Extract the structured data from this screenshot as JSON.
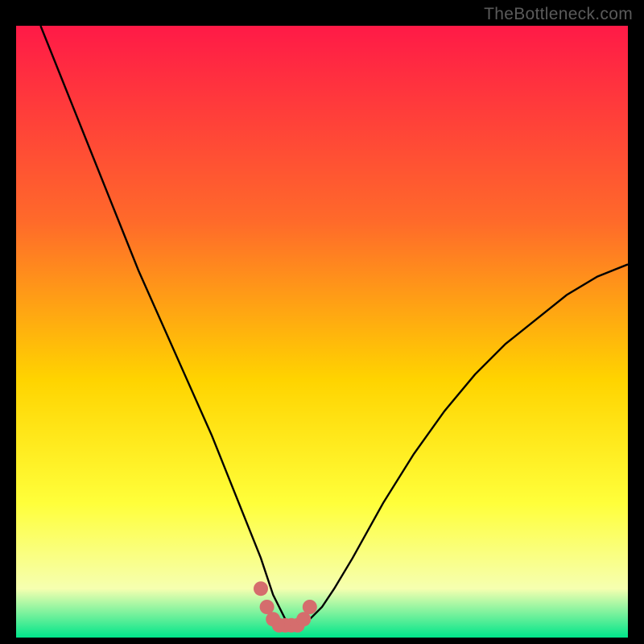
{
  "watermark": "TheBottleneck.com",
  "colors": {
    "gradient_top": "#ff1a47",
    "gradient_mid1": "#ff6a2a",
    "gradient_mid2": "#ffd400",
    "gradient_mid3": "#ffff3a",
    "gradient_mid4": "#f6ffb0",
    "gradient_bottom": "#00e58a",
    "curve": "#000000",
    "marker": "#d56d6d"
  },
  "chart_data": {
    "type": "line",
    "title": "",
    "xlabel": "",
    "ylabel": "",
    "xlim": [
      0,
      100
    ],
    "ylim": [
      0,
      100
    ],
    "series": [
      {
        "name": "curve",
        "x": [
          4,
          8,
          12,
          16,
          20,
          24,
          28,
          32,
          34,
          36,
          38,
          40,
          41,
          42,
          43,
          44,
          45,
          46,
          47,
          48,
          50,
          52,
          55,
          60,
          65,
          70,
          75,
          80,
          85,
          90,
          95,
          100
        ],
        "y": [
          100,
          90,
          80,
          70,
          60,
          51,
          42,
          33,
          28,
          23,
          18,
          13,
          10,
          7,
          5,
          3,
          2,
          2,
          2,
          3,
          5,
          8,
          13,
          22,
          30,
          37,
          43,
          48,
          52,
          56,
          59,
          61
        ]
      },
      {
        "name": "markers",
        "x": [
          40,
          41,
          42,
          43,
          44,
          45,
          46,
          47,
          48
        ],
        "y": [
          8,
          5,
          3,
          2,
          2,
          2,
          2,
          3,
          5
        ]
      }
    ]
  }
}
